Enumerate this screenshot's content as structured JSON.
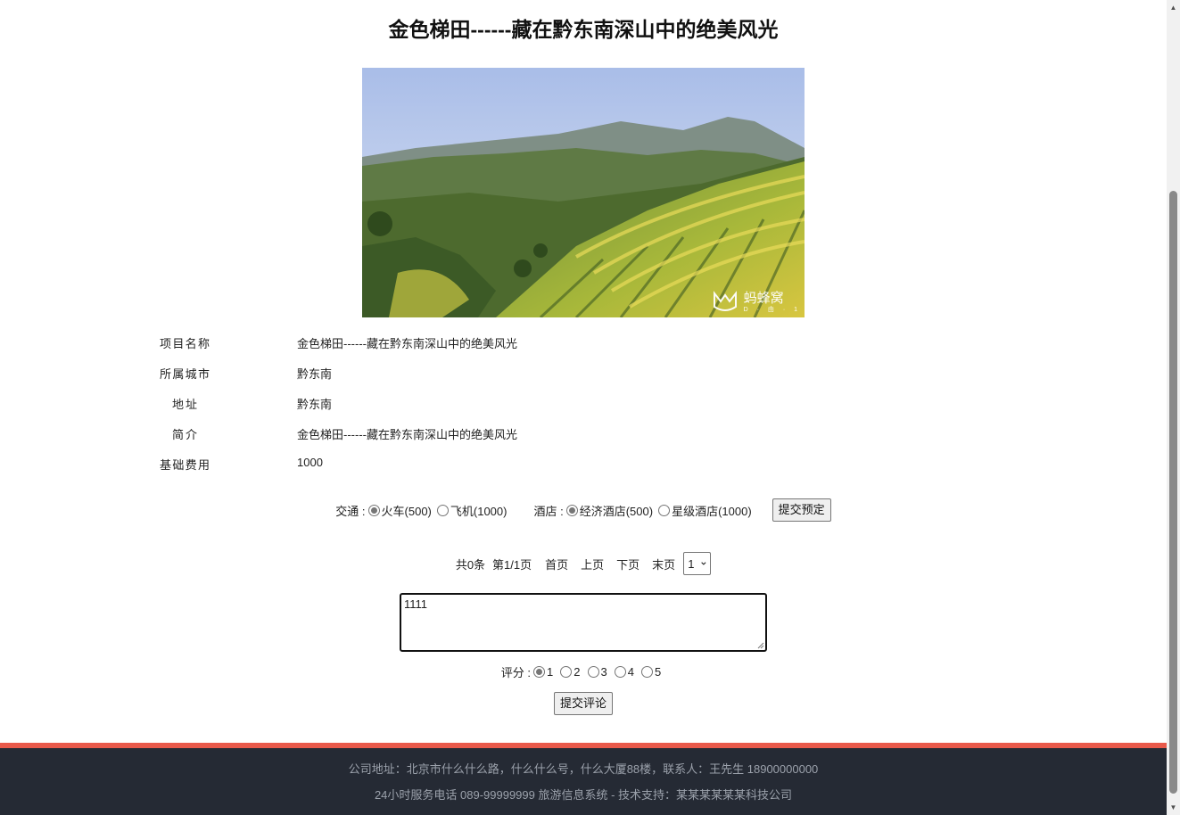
{
  "page": {
    "title": "金色梯田------藏在黔东南深山中的绝美风光"
  },
  "hero_image": {
    "alt": "梯田风景",
    "watermark": "蚂蜂窝",
    "watermark_sub": "D · 由 · 1"
  },
  "details": [
    {
      "label": "项目名称",
      "value": "金色梯田------藏在黔东南深山中的绝美风光"
    },
    {
      "label": "所属城市",
      "value": "黔东南"
    },
    {
      "label": "地址",
      "value": "黔东南"
    },
    {
      "label": "简介",
      "value": "金色梯田------藏在黔东南深山中的绝美风光"
    },
    {
      "label": "基础费用",
      "value": "1000"
    }
  ],
  "booking": {
    "transport_label": "交通 :",
    "transport_options": [
      {
        "label": "火车(500)",
        "selected": true
      },
      {
        "label": "飞机(1000)",
        "selected": false
      }
    ],
    "hotel_label": "酒店 :",
    "hotel_options": [
      {
        "label": "经济酒店(500)",
        "selected": true
      },
      {
        "label": "星级酒店(1000)",
        "selected": false
      }
    ],
    "submit_label": "提交预定"
  },
  "pager": {
    "total": "共0条",
    "page_info": "第1/1页",
    "first": "首页",
    "prev": "上页",
    "next": "下页",
    "last": "末页",
    "selected_page": "1"
  },
  "comment": {
    "text": "1111",
    "rating_label": "评分 :",
    "rating_options": [
      "1",
      "2",
      "3",
      "4",
      "5"
    ],
    "rating_selected": "1",
    "submit_label": "提交评论"
  },
  "footer": {
    "line1": "公司地址：北京市什么什么路，什么什么号，什么大厦88楼，联系人：王先生 18900000000",
    "line2": "24小时服务电话   089-99999999   旅游信息系统 - 技术支持：某某某某某某科技公司"
  },
  "colors": {
    "footer_bg": "#252a34",
    "footer_accent": "#e8594a",
    "footer_text": "#9ba1ab"
  }
}
